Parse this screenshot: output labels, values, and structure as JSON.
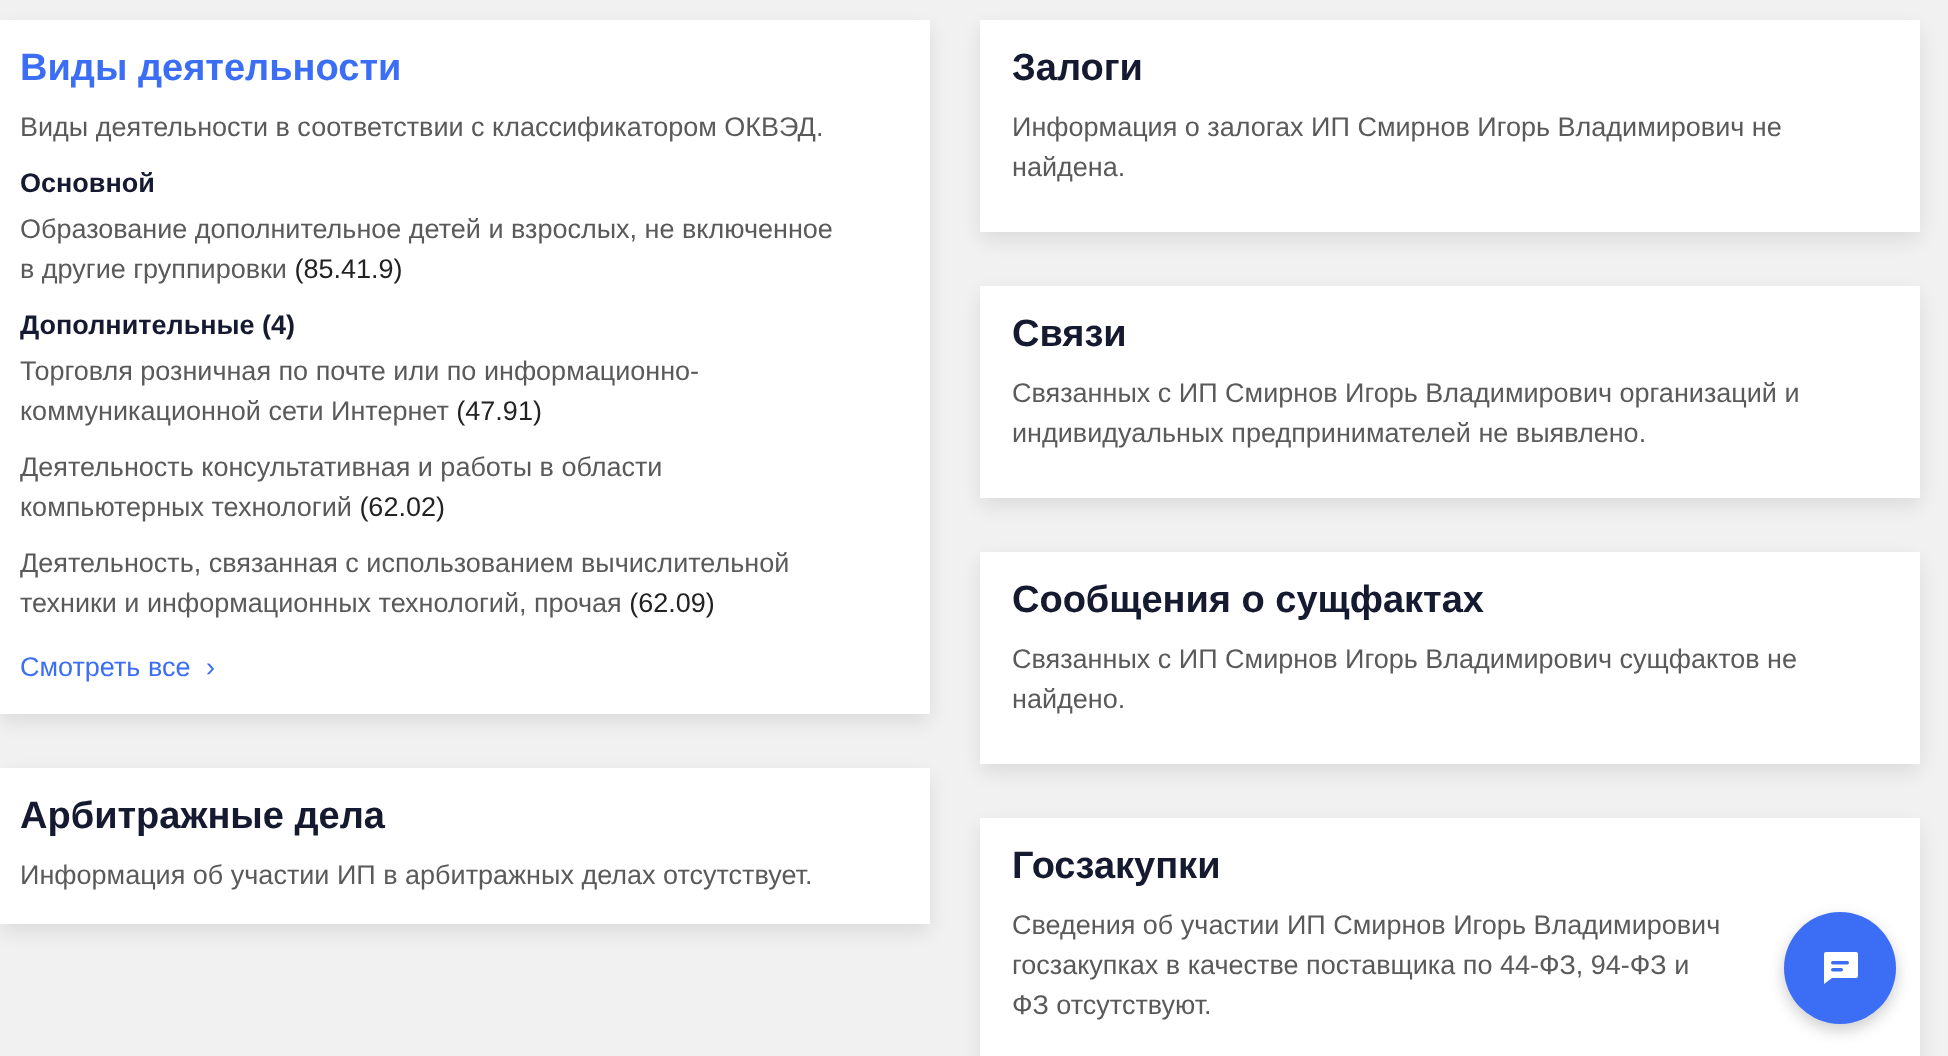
{
  "columns": [
    {
      "cards": [
        {
          "title": "Виды деятельности",
          "title_active": true,
          "description": "Виды деятельности в соответствии с классификатором ОКВЭД.",
          "sections": [
            {
              "heading": "Основной",
              "items": [
                "Образование дополнительное детей и взрослых, не включенное в другие группировки **(85.41.9)**"
              ]
            },
            {
              "heading": "Дополнительные (4)",
              "items": [
                "Торговля розничная по почте или по информационно-коммуникационной сети Интернет **(47.91)**",
                "Деятельность консультативная и работы в области компьютерных технологий **(62.02)**",
                "Деятельность, связанная с использованием вычислительной техники и информационных технологий, прочая **(62.09)**"
              ]
            }
          ],
          "more_link": "Смотреть все",
          "more_icon": "›"
        },
        {
          "title": "Арбитражные дела",
          "title_active": false,
          "description": "Информация об участии ИП в арбитражных делах отсутствует."
        }
      ]
    },
    {
      "cards": [
        {
          "title": "Залоги",
          "title_active": false,
          "description": "Информация о залогах ИП Смирнов Игорь Владимирович не найдена."
        },
        {
          "title": "Связи",
          "title_active": false,
          "description": "Связанных с ИП Смирнов Игорь Владимирович организаций и индивидуальных предпринимателей не выявлено."
        },
        {
          "title": "Сообщения о сущфактах",
          "title_active": false,
          "description": "Связанных с ИП Смирнов Игорь Владимирович сущфактов не найдено."
        },
        {
          "title": "Госзакупки",
          "title_active": false,
          "description_lines": [
            "Сведения об участии ИП Смирнов Игорь Владимирович",
            "госзакупках в качестве поставщика по 44-ФЗ, 94-ФЗ и",
            "ФЗ отсутствуют."
          ]
        }
      ]
    }
  ]
}
